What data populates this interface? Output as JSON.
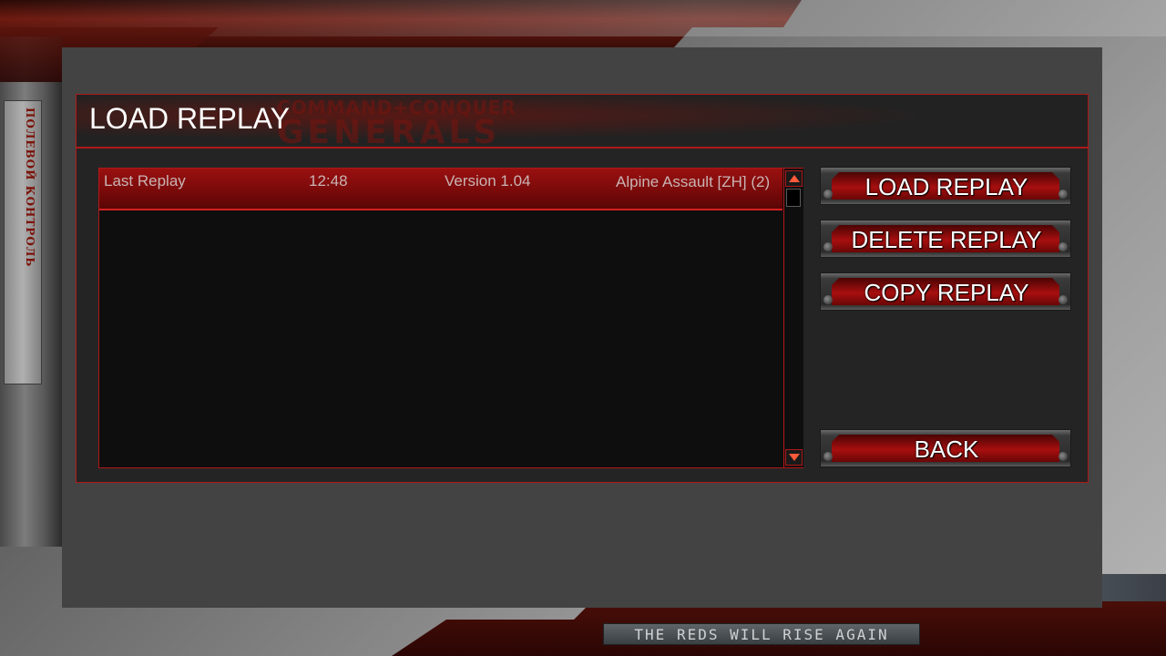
{
  "dialog": {
    "title": "LOAD REPLAY",
    "logo_line1": "COMMAND+CONQUER",
    "logo_line2": "GENERALS"
  },
  "replay_list": {
    "rows": [
      {
        "name": "Last Replay",
        "time": "12:48",
        "version": "Version 1.04",
        "map": "Alpine Assault [ZH] (2)",
        "selected": true
      }
    ]
  },
  "buttons": {
    "load": "LOAD REPLAY",
    "delete": "DELETE REPLAY",
    "copy": "COPY REPLAY",
    "back": "BACK"
  },
  "frame": {
    "slogan": "THE REDS WILL RISE AGAIN",
    "left_text": "ПОЛЕВОЙ КОНТРОЛЬ"
  },
  "icons": {
    "scroll_up": "triangle-up-icon",
    "scroll_down": "triangle-down-icon"
  },
  "colors": {
    "accent_red": "#b01818",
    "selected_row": "#8e0c0c",
    "panel_bg": "#242424",
    "list_bg": "#0e0e0e"
  }
}
